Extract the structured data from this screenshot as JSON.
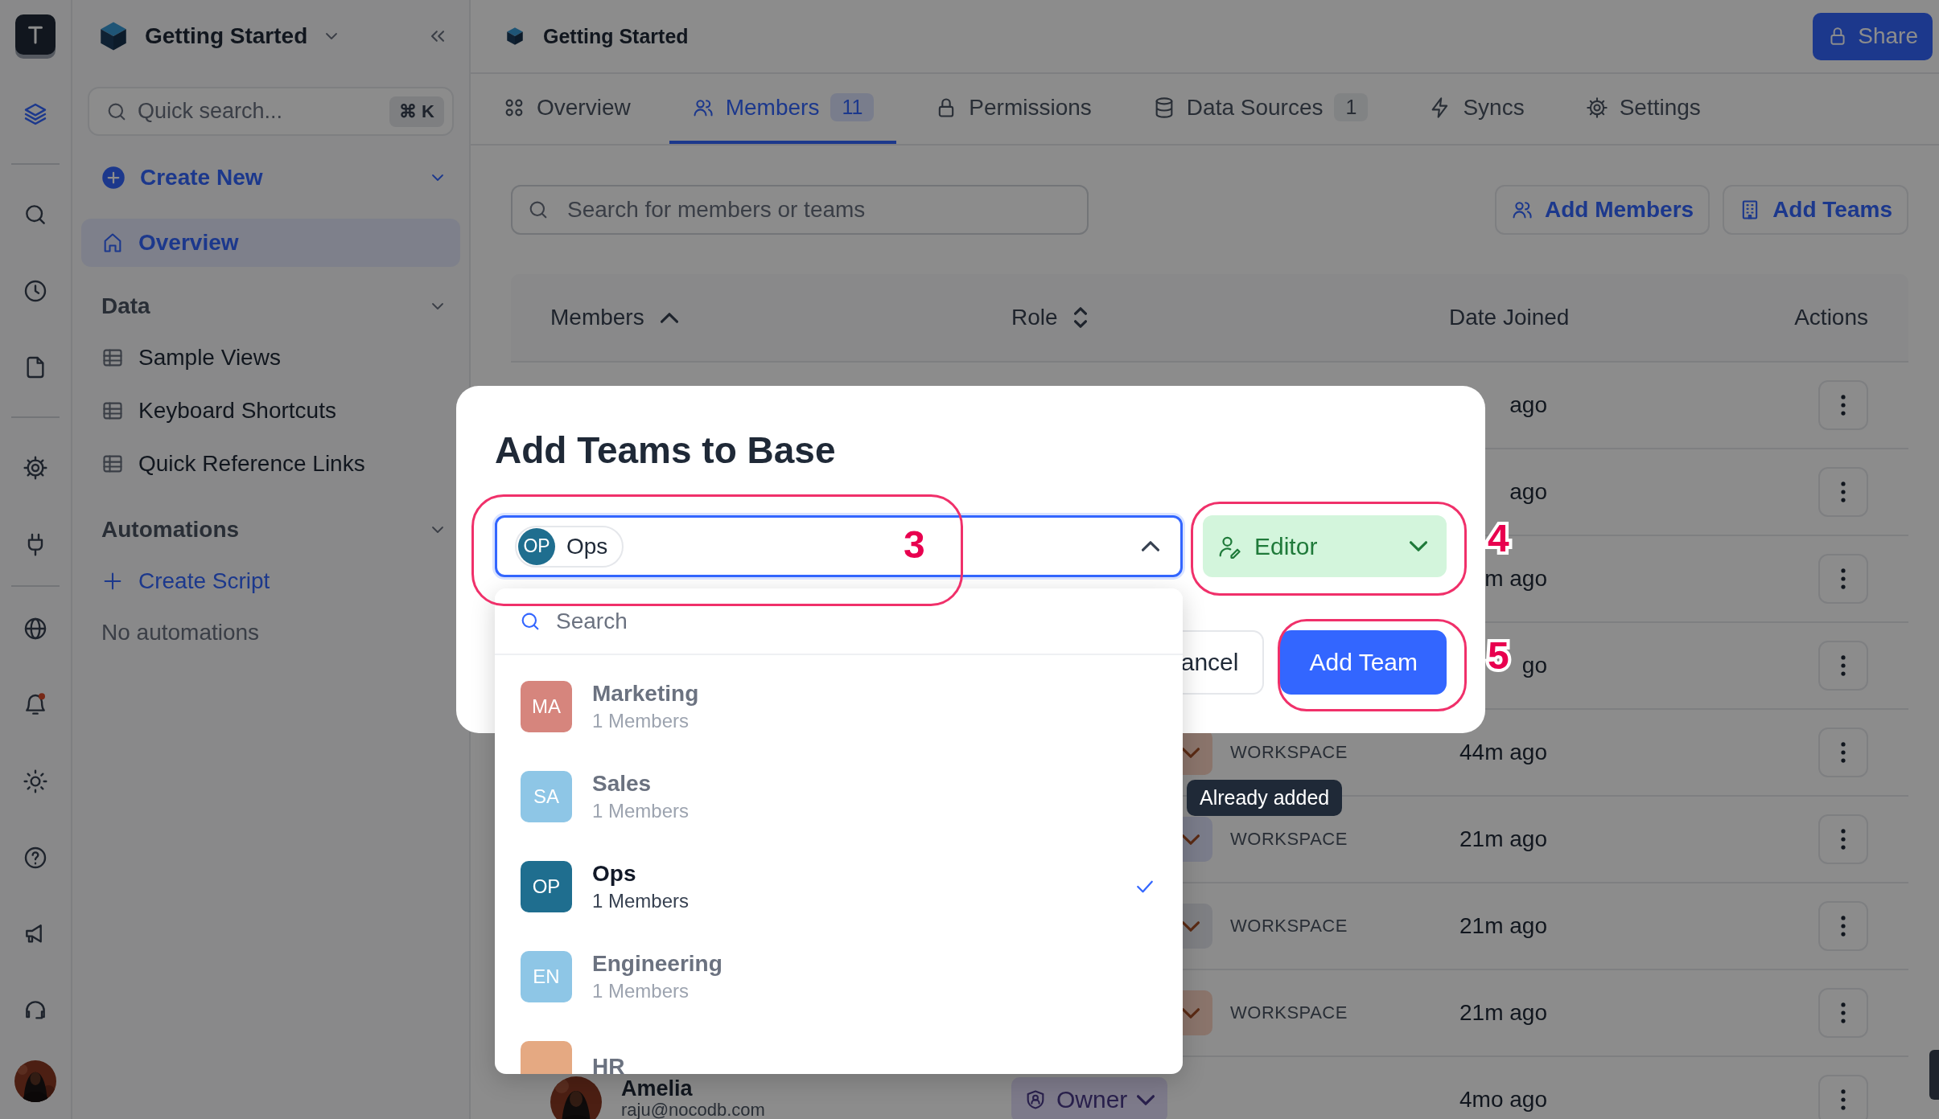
{
  "sidebar": {
    "title": "Getting Started",
    "search": {
      "placeholder": "Quick search...",
      "shortcut": "⌘ K"
    },
    "create_new": "Create New",
    "nav": [
      {
        "label": "Overview",
        "selected": true
      }
    ],
    "sections": [
      {
        "title": "Data",
        "expanded": true,
        "items": [
          {
            "label": "Sample Views",
            "selected": false
          },
          {
            "label": "Keyboard Shortcuts",
            "selected": false
          },
          {
            "label": "Quick Reference Links",
            "selected": false
          }
        ]
      },
      {
        "title": "Automations",
        "expanded": true,
        "action": "Create Script",
        "empty_text": "No automations"
      }
    ]
  },
  "header": {
    "title": "Getting Started",
    "share": "Share"
  },
  "tabs": [
    {
      "label": "Overview",
      "selected": false
    },
    {
      "label": "Members",
      "count": "11",
      "selected": true
    },
    {
      "label": "Permissions",
      "selected": false
    },
    {
      "label": "Data Sources",
      "count": "1",
      "selected": false
    },
    {
      "label": "Syncs",
      "selected": false
    },
    {
      "label": "Settings",
      "selected": false
    }
  ],
  "toolbar": {
    "search_placeholder": "Search for members or teams",
    "buttons": [
      "Add Members",
      "Add Teams"
    ]
  },
  "table": {
    "columns": [
      {
        "label": "Members",
        "sorted": true
      },
      {
        "label": "Role",
        "sorted": false
      },
      {
        "label": "Date Joined"
      },
      {
        "label": "Actions"
      }
    ],
    "rows": [
      {
        "date": "ago"
      },
      {
        "date": "ago"
      },
      {
        "date": "m ago"
      },
      {
        "date": "go"
      },
      {
        "role": {
          "color": "#8a746b"
        },
        "scope": "WORKSPACE",
        "date": "44m ago"
      },
      {
        "role": {
          "color": "#7a7c8a"
        },
        "scope": "WORKSPACE",
        "date": "21m ago"
      },
      {
        "role": {
          "color": "#7e7f83"
        },
        "scope": "WORKSPACE",
        "date": "21m ago"
      },
      {
        "role": {
          "color": "#8a746b"
        },
        "scope": "WORKSPACE",
        "date": "21m ago"
      },
      {
        "name": "Amelia",
        "email": "raju@nocodb.com",
        "role": {
          "label": "Owner",
          "color": "#7d7a8a"
        },
        "date": "4mo ago"
      }
    ]
  },
  "modal": {
    "title": "Add Teams to Base",
    "team_select": {
      "expanded": true,
      "chips": [
        {
          "initials": "OP",
          "label": "Ops",
          "color": "#1f6e8f"
        }
      ]
    },
    "role_select": {
      "label": "Editor"
    },
    "buttons": [
      {
        "label": "ancel",
        "kind": "secondary"
      },
      {
        "label": "Add Team",
        "kind": "primary"
      }
    ],
    "dropdown": {
      "search_placeholder": "Search",
      "items": [
        {
          "initials": "MA",
          "name": "Marketing",
          "members": "1 Members",
          "color": "#d6857d",
          "disabled": true,
          "selected": false
        },
        {
          "initials": "SA",
          "name": "Sales",
          "members": "1 Members",
          "color": "#8ec6e6",
          "disabled": true,
          "selected": false
        },
        {
          "initials": "OP",
          "name": "Ops",
          "members": "1 Members",
          "color": "#1f6e8f",
          "disabled": false,
          "selected": true
        },
        {
          "initials": "EN",
          "name": "Engineering",
          "members": "1 Members",
          "color": "#8ec6e6",
          "disabled": true,
          "selected": false
        },
        {
          "name": "HR",
          "color": "#e5a982",
          "disabled": true,
          "selected": false
        }
      ]
    },
    "tooltip": "Already added",
    "annotations": [
      {
        "label": "3"
      },
      {
        "label": "4"
      },
      {
        "label": "5"
      }
    ]
  }
}
